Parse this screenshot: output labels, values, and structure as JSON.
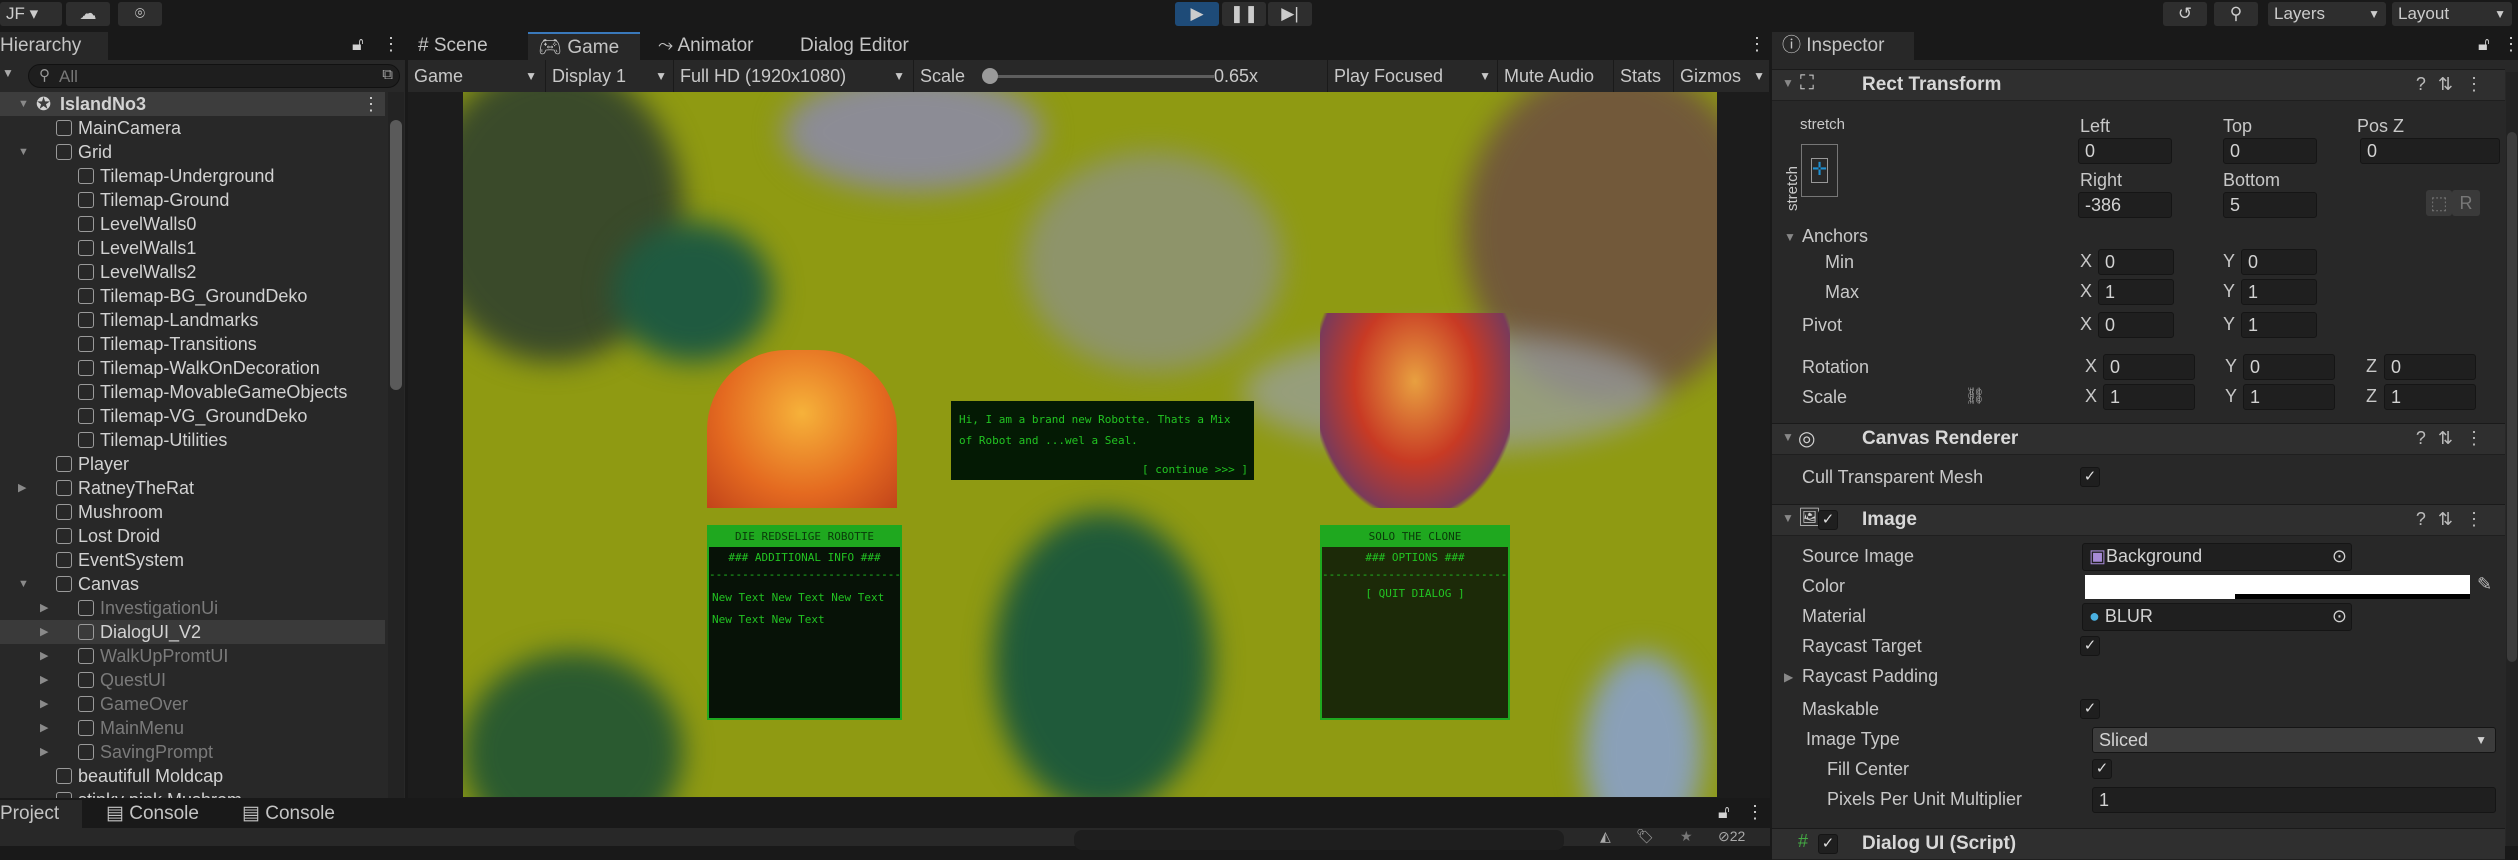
{
  "topbar": {
    "account": "JF",
    "account_arrow": "▾",
    "layers": "Layers",
    "layout": "Layout",
    "play_icon": "play",
    "pause_icon": "pause",
    "step_icon": "step"
  },
  "hierarchy": {
    "tab": "Hierarchy",
    "search_placeholder": "All",
    "scene": "IslandNo3",
    "items": [
      {
        "label": "MainCamera",
        "depth": 1,
        "arrow": "",
        "dim": false
      },
      {
        "label": "Grid",
        "depth": 1,
        "arrow": "▼",
        "dim": false
      },
      {
        "label": "Tilemap-Underground",
        "depth": 2,
        "arrow": "",
        "dim": false
      },
      {
        "label": "Tilemap-Ground",
        "depth": 2,
        "arrow": "",
        "dim": false
      },
      {
        "label": "LevelWalls0",
        "depth": 2,
        "arrow": "",
        "dim": false
      },
      {
        "label": "LevelWalls1",
        "depth": 2,
        "arrow": "",
        "dim": false
      },
      {
        "label": "LevelWalls2",
        "depth": 2,
        "arrow": "",
        "dim": false
      },
      {
        "label": "Tilemap-BG_GroundDeko",
        "depth": 2,
        "arrow": "",
        "dim": false
      },
      {
        "label": "Tilemap-Landmarks",
        "depth": 2,
        "arrow": "",
        "dim": false
      },
      {
        "label": "Tilemap-Transitions",
        "depth": 2,
        "arrow": "",
        "dim": false
      },
      {
        "label": "Tilemap-WalkOnDecoration",
        "depth": 2,
        "arrow": "",
        "dim": false
      },
      {
        "label": "Tilemap-MovableGameObjects",
        "depth": 2,
        "arrow": "",
        "dim": false
      },
      {
        "label": "Tilemap-VG_GroundDeko",
        "depth": 2,
        "arrow": "",
        "dim": false
      },
      {
        "label": "Tilemap-Utilities",
        "depth": 2,
        "arrow": "",
        "dim": false
      },
      {
        "label": "Player",
        "depth": 1,
        "arrow": "",
        "dim": false
      },
      {
        "label": "RatneyTheRat",
        "depth": 1,
        "arrow": "▶",
        "dim": false
      },
      {
        "label": "Mushroom",
        "depth": 1,
        "arrow": "",
        "dim": false
      },
      {
        "label": "Lost Droid",
        "depth": 1,
        "arrow": "",
        "dim": false
      },
      {
        "label": "EventSystem",
        "depth": 1,
        "arrow": "",
        "dim": false
      },
      {
        "label": "Canvas",
        "depth": 1,
        "arrow": "▼",
        "dim": false
      },
      {
        "label": "InvestigationUi",
        "depth": 2,
        "arrow": "▶",
        "dim": true
      },
      {
        "label": "DialogUI_V2",
        "depth": 2,
        "arrow": "▶",
        "dim": false,
        "selected": true
      },
      {
        "label": "WalkUpPromtUI",
        "depth": 2,
        "arrow": "▶",
        "dim": true
      },
      {
        "label": "QuestUI",
        "depth": 2,
        "arrow": "▶",
        "dim": true
      },
      {
        "label": "GameOver",
        "depth": 2,
        "arrow": "▶",
        "dim": true
      },
      {
        "label": "MainMenu",
        "depth": 2,
        "arrow": "▶",
        "dim": true
      },
      {
        "label": "SavingPrompt",
        "depth": 2,
        "arrow": "▶",
        "dim": true
      },
      {
        "label": "beautifull Moldcap",
        "depth": 1,
        "arrow": "",
        "dim": false
      },
      {
        "label": "stinky pink Mushrom",
        "depth": 1,
        "arrow": "",
        "dim": false
      }
    ]
  },
  "center_tabs": [
    "Scene",
    "Game",
    "Animator",
    "Dialog Editor"
  ],
  "game_toolbar": {
    "view": "Game",
    "display": "Display 1",
    "resolution": "Full HD (1920x1080)",
    "scale_label": "Scale",
    "scale_value": "0.65x",
    "scale_fraction": 0.0,
    "play_mode": "Play Focused",
    "mute": "Mute Audio",
    "stats": "Stats",
    "gizmos": "Gizmos"
  },
  "game": {
    "left_name": "DIE REDSELIGE ROBOTTE",
    "left_header": "### ADDITIONAL INFO ###",
    "left_divider": "--------------------------------",
    "left_body": "New Text New Text New Text New Text New Text",
    "speech": "Hi, I am a brand new Robotte. Thats a Mix of Robot and ...wel a Seal.",
    "continue": "[ continue >>> ]",
    "right_name": "SOLO THE CLONE",
    "right_header": "### OPTIONS ###",
    "right_divider": "--------------------------------",
    "quit": "[ QUIT DIALOG ]"
  },
  "bottom": {
    "tabs": [
      "Project",
      "Console",
      "Console"
    ],
    "hidden_count": "22"
  },
  "inspector": {
    "tab": "Inspector",
    "rect": {
      "title": "Rect Transform",
      "anchor_h": "stretch",
      "anchor_v": "stretch",
      "left_label": "Left",
      "top_label": "Top",
      "posz_label": "Pos Z",
      "right_label": "Right",
      "bottom_label": "Bottom",
      "left": "0",
      "top": "0",
      "posz": "0",
      "right": "-386",
      "bottom": "5",
      "r_btn": "R",
      "anchors": "Anchors",
      "min": "Min",
      "max": "Max",
      "pivot": "Pivot",
      "rotation": "Rotation",
      "scale": "Scale",
      "x": "X",
      "y": "Y",
      "z": "Z",
      "min_x": "0",
      "min_y": "0",
      "max_x": "1",
      "max_y": "1",
      "pivot_x": "0",
      "pivot_y": "1",
      "rot_x": "0",
      "rot_y": "0",
      "rot_z": "0",
      "scale_x": "1",
      "scale_y": "1",
      "scale_z": "1"
    },
    "canvas_renderer": {
      "title": "Canvas Renderer",
      "cull": "Cull Transparent Mesh",
      "cull_checked": true
    },
    "image": {
      "title": "Image",
      "enabled": true,
      "source_label": "Source Image",
      "source": "Background",
      "color_label": "Color",
      "color": "#ffffff",
      "material_label": "Material",
      "material": "BLUR",
      "raycast_target": "Raycast Target",
      "raycast_padding": "Raycast Padding",
      "maskable": "Maskable",
      "image_type_label": "Image Type",
      "image_type": "Sliced",
      "fill_center": "Fill Center",
      "ppu_label": "Pixels Per Unit Multiplier",
      "ppu": "1"
    },
    "script": {
      "title": "Dialog UI (Script)"
    }
  }
}
